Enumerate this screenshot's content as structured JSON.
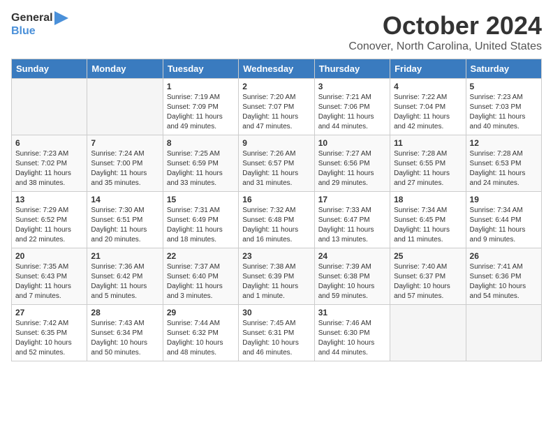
{
  "logo": {
    "line1": "General",
    "line2": "Blue"
  },
  "title": "October 2024",
  "location": "Conover, North Carolina, United States",
  "days_of_week": [
    "Sunday",
    "Monday",
    "Tuesday",
    "Wednesday",
    "Thursday",
    "Friday",
    "Saturday"
  ],
  "weeks": [
    [
      {
        "day": "",
        "empty": true
      },
      {
        "day": "",
        "empty": true
      },
      {
        "day": "1",
        "sunrise": "Sunrise: 7:19 AM",
        "sunset": "Sunset: 7:09 PM",
        "daylight": "Daylight: 11 hours and 49 minutes."
      },
      {
        "day": "2",
        "sunrise": "Sunrise: 7:20 AM",
        "sunset": "Sunset: 7:07 PM",
        "daylight": "Daylight: 11 hours and 47 minutes."
      },
      {
        "day": "3",
        "sunrise": "Sunrise: 7:21 AM",
        "sunset": "Sunset: 7:06 PM",
        "daylight": "Daylight: 11 hours and 44 minutes."
      },
      {
        "day": "4",
        "sunrise": "Sunrise: 7:22 AM",
        "sunset": "Sunset: 7:04 PM",
        "daylight": "Daylight: 11 hours and 42 minutes."
      },
      {
        "day": "5",
        "sunrise": "Sunrise: 7:23 AM",
        "sunset": "Sunset: 7:03 PM",
        "daylight": "Daylight: 11 hours and 40 minutes."
      }
    ],
    [
      {
        "day": "6",
        "sunrise": "Sunrise: 7:23 AM",
        "sunset": "Sunset: 7:02 PM",
        "daylight": "Daylight: 11 hours and 38 minutes."
      },
      {
        "day": "7",
        "sunrise": "Sunrise: 7:24 AM",
        "sunset": "Sunset: 7:00 PM",
        "daylight": "Daylight: 11 hours and 35 minutes."
      },
      {
        "day": "8",
        "sunrise": "Sunrise: 7:25 AM",
        "sunset": "Sunset: 6:59 PM",
        "daylight": "Daylight: 11 hours and 33 minutes."
      },
      {
        "day": "9",
        "sunrise": "Sunrise: 7:26 AM",
        "sunset": "Sunset: 6:57 PM",
        "daylight": "Daylight: 11 hours and 31 minutes."
      },
      {
        "day": "10",
        "sunrise": "Sunrise: 7:27 AM",
        "sunset": "Sunset: 6:56 PM",
        "daylight": "Daylight: 11 hours and 29 minutes."
      },
      {
        "day": "11",
        "sunrise": "Sunrise: 7:28 AM",
        "sunset": "Sunset: 6:55 PM",
        "daylight": "Daylight: 11 hours and 27 minutes."
      },
      {
        "day": "12",
        "sunrise": "Sunrise: 7:28 AM",
        "sunset": "Sunset: 6:53 PM",
        "daylight": "Daylight: 11 hours and 24 minutes."
      }
    ],
    [
      {
        "day": "13",
        "sunrise": "Sunrise: 7:29 AM",
        "sunset": "Sunset: 6:52 PM",
        "daylight": "Daylight: 11 hours and 22 minutes."
      },
      {
        "day": "14",
        "sunrise": "Sunrise: 7:30 AM",
        "sunset": "Sunset: 6:51 PM",
        "daylight": "Daylight: 11 hours and 20 minutes."
      },
      {
        "day": "15",
        "sunrise": "Sunrise: 7:31 AM",
        "sunset": "Sunset: 6:49 PM",
        "daylight": "Daylight: 11 hours and 18 minutes."
      },
      {
        "day": "16",
        "sunrise": "Sunrise: 7:32 AM",
        "sunset": "Sunset: 6:48 PM",
        "daylight": "Daylight: 11 hours and 16 minutes."
      },
      {
        "day": "17",
        "sunrise": "Sunrise: 7:33 AM",
        "sunset": "Sunset: 6:47 PM",
        "daylight": "Daylight: 11 hours and 13 minutes."
      },
      {
        "day": "18",
        "sunrise": "Sunrise: 7:34 AM",
        "sunset": "Sunset: 6:45 PM",
        "daylight": "Daylight: 11 hours and 11 minutes."
      },
      {
        "day": "19",
        "sunrise": "Sunrise: 7:34 AM",
        "sunset": "Sunset: 6:44 PM",
        "daylight": "Daylight: 11 hours and 9 minutes."
      }
    ],
    [
      {
        "day": "20",
        "sunrise": "Sunrise: 7:35 AM",
        "sunset": "Sunset: 6:43 PM",
        "daylight": "Daylight: 11 hours and 7 minutes."
      },
      {
        "day": "21",
        "sunrise": "Sunrise: 7:36 AM",
        "sunset": "Sunset: 6:42 PM",
        "daylight": "Daylight: 11 hours and 5 minutes."
      },
      {
        "day": "22",
        "sunrise": "Sunrise: 7:37 AM",
        "sunset": "Sunset: 6:40 PM",
        "daylight": "Daylight: 11 hours and 3 minutes."
      },
      {
        "day": "23",
        "sunrise": "Sunrise: 7:38 AM",
        "sunset": "Sunset: 6:39 PM",
        "daylight": "Daylight: 11 hours and 1 minute."
      },
      {
        "day": "24",
        "sunrise": "Sunrise: 7:39 AM",
        "sunset": "Sunset: 6:38 PM",
        "daylight": "Daylight: 10 hours and 59 minutes."
      },
      {
        "day": "25",
        "sunrise": "Sunrise: 7:40 AM",
        "sunset": "Sunset: 6:37 PM",
        "daylight": "Daylight: 10 hours and 57 minutes."
      },
      {
        "day": "26",
        "sunrise": "Sunrise: 7:41 AM",
        "sunset": "Sunset: 6:36 PM",
        "daylight": "Daylight: 10 hours and 54 minutes."
      }
    ],
    [
      {
        "day": "27",
        "sunrise": "Sunrise: 7:42 AM",
        "sunset": "Sunset: 6:35 PM",
        "daylight": "Daylight: 10 hours and 52 minutes."
      },
      {
        "day": "28",
        "sunrise": "Sunrise: 7:43 AM",
        "sunset": "Sunset: 6:34 PM",
        "daylight": "Daylight: 10 hours and 50 minutes."
      },
      {
        "day": "29",
        "sunrise": "Sunrise: 7:44 AM",
        "sunset": "Sunset: 6:32 PM",
        "daylight": "Daylight: 10 hours and 48 minutes."
      },
      {
        "day": "30",
        "sunrise": "Sunrise: 7:45 AM",
        "sunset": "Sunset: 6:31 PM",
        "daylight": "Daylight: 10 hours and 46 minutes."
      },
      {
        "day": "31",
        "sunrise": "Sunrise: 7:46 AM",
        "sunset": "Sunset: 6:30 PM",
        "daylight": "Daylight: 10 hours and 44 minutes."
      },
      {
        "day": "",
        "empty": true
      },
      {
        "day": "",
        "empty": true
      }
    ]
  ]
}
